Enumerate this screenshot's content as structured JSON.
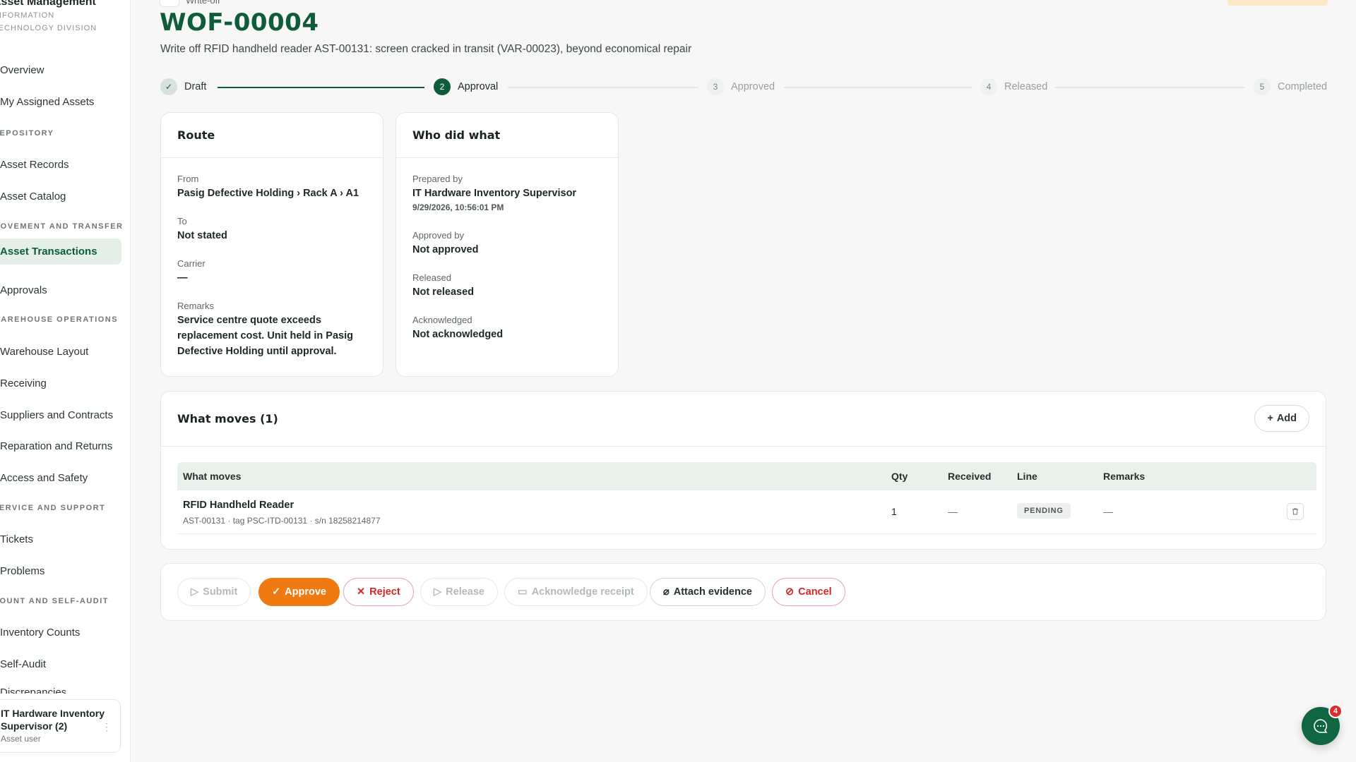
{
  "sidebar": {
    "brand_title": "Asset Management",
    "brand_subtitle": "INFORMATION TECHNOLOGY DIVISION",
    "items": {
      "overview": "Overview",
      "assigned_assets": "My Assigned Assets",
      "asset_records": "Asset Records",
      "asset_catalog": "Asset Catalog",
      "asset_transactions": "Asset Transactions",
      "approvals": "Approvals",
      "warehouse_layout": "Warehouse Layout",
      "receiving": "Receiving",
      "suppliers_contracts": "Suppliers and Contracts",
      "reparation_returns": "Reparation and Returns",
      "access_safety": "Access and Safety",
      "tickets": "Tickets",
      "problems": "Problems",
      "inventory_counts": "Inventory Counts",
      "audit": "Self-Audit",
      "cut_off": "Discrepancies"
    },
    "sections": {
      "repository": "REPOSITORY",
      "movement": "MOVEMENT AND TRANSFER",
      "warehouse_ops": "WAREHOUSE OPERATIONS",
      "service_support": "SERVICE AND SUPPORT",
      "count_audit": "COUNT AND SELF-AUDIT"
    },
    "user": {
      "name": "IT Hardware Inventory Supervisor (2)",
      "role": "Asset user"
    }
  },
  "header": {
    "breadcrumb": "Write-off",
    "doc_id": "WOF-00004",
    "description": "Write off RFID handheld reader AST-00131: screen cracked in transit (VAR-00023), beyond economical repair"
  },
  "stepper": {
    "steps": [
      {
        "num": "✓",
        "label": "Draft",
        "state": "done"
      },
      {
        "num": "2",
        "label": "Approval",
        "state": "current"
      },
      {
        "num": "3",
        "label": "Approved",
        "state": "pending"
      },
      {
        "num": "4",
        "label": "Released",
        "state": "pending"
      },
      {
        "num": "5",
        "label": "Completed",
        "state": "pending"
      }
    ]
  },
  "route": {
    "title": "Route",
    "from_label": "From",
    "from_value": "Pasig Defective Holding › Rack A › A1",
    "to_label": "To",
    "to_value": "Not stated",
    "carrier_label": "Carrier",
    "carrier_value": "—",
    "remarks_label": "Remarks",
    "remarks_value": "Service centre quote exceeds replacement cost. Unit held in Pasig Defective Holding until approval."
  },
  "who": {
    "title": "Who did what",
    "prepared_label": "Prepared by",
    "prepared_value": "IT Hardware Inventory Supervisor",
    "prepared_time": "9/29/2026, 10:56:01 PM",
    "approved_label": "Approved by",
    "approved_value": "Not approved",
    "released_label": "Released",
    "released_value": "Not released",
    "ack_label": "Acknowledged",
    "ack_value": "Not acknowledged"
  },
  "moves": {
    "title": "What moves (1)",
    "add_label": "Add",
    "columns": {
      "item": "What moves",
      "qty": "Qty",
      "received": "Received",
      "line": "Line",
      "remarks": "Remarks"
    },
    "rows": [
      {
        "name": "RFID Handheld Reader",
        "meta": "AST-00131 · tag PSC-ITD-00131 · s/n 18258214877",
        "qty": "1",
        "received": "—",
        "line": "PENDING",
        "remarks": "—"
      }
    ]
  },
  "actions": {
    "submit": "Submit",
    "approve": "Approve",
    "reject": "Reject",
    "release": "Release",
    "acknowledge": "Acknowledge receipt",
    "attach": "Attach evidence",
    "cancel": "Cancel"
  },
  "chat": {
    "count": "4"
  },
  "colors": {
    "brand": "#0f5c3a",
    "accent": "#f07a12",
    "danger": "#d02828"
  }
}
